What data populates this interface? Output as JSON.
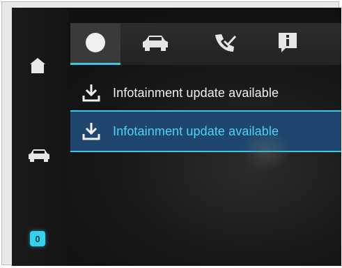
{
  "rail": {
    "home_icon": "home-icon",
    "car_icon": "car-icon",
    "badge_value": "0"
  },
  "tabs": [
    {
      "icon": "circle-icon",
      "selected": true
    },
    {
      "icon": "car-icon",
      "selected": false
    },
    {
      "icon": "phone-check-icon",
      "selected": false
    },
    {
      "icon": "info-icon",
      "selected": false
    }
  ],
  "notifications": [
    {
      "label": "Infotainment update available",
      "icon": "download-icon",
      "selected": false
    },
    {
      "label": "Infotainment update available",
      "icon": "download-icon",
      "selected": true
    }
  ],
  "colors": {
    "accent": "#37c8ea",
    "selected_row": "#1f466e",
    "background": "#141414"
  }
}
